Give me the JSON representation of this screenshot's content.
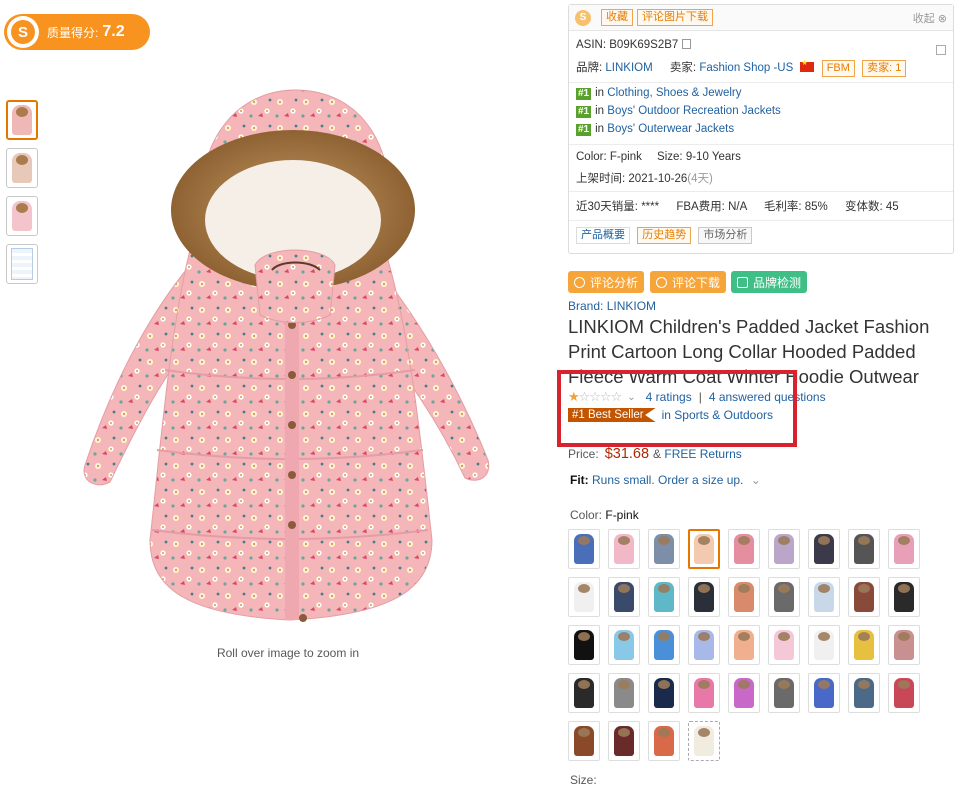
{
  "score_badge": {
    "logo": "S",
    "label": "质量得分:",
    "value": "7.2"
  },
  "thumbnails": [
    "jacket-front",
    "jacket-hood",
    "jacket-side",
    "size-chart"
  ],
  "zoom_hint": "Roll over image to zoom in",
  "info_panel": {
    "logo": "S",
    "btn_favorite": "收藏",
    "btn_review_images": "评论图片下载",
    "collapse": "收起",
    "asin_label": "ASIN:",
    "asin": "B09K69S2B7",
    "brand_label": "品牌:",
    "brand": "LINKIOM",
    "seller_label": "卖家:",
    "seller": "Fashion Shop -US",
    "fulfillment": "FBM",
    "seller_count": "卖家: 1",
    "ranks": [
      {
        "badge": "#1",
        "prefix": "in",
        "category": "Clothing, Shoes & Jewelry"
      },
      {
        "badge": "#1",
        "prefix": "in",
        "category": "Boys' Outdoor Recreation Jackets"
      },
      {
        "badge": "#1",
        "prefix": "in",
        "category": "Boys' Outerwear Jackets"
      }
    ],
    "color_label": "Color:",
    "color_value": "F-pink",
    "size_label": "Size:",
    "size_value": "9-10 Years",
    "listed_label": "上架时间:",
    "listed_date": "2021-10-26",
    "listed_days": "(4天)",
    "sales_label": "近30天销量:",
    "sales_value": "****",
    "fba_label": "FBA费用:",
    "fba_value": "N/A",
    "margin_label": "毛利率:",
    "margin_value": "85%",
    "variants_label": "变体数:",
    "variants_value": "45",
    "tab_overview": "产品概要",
    "tab_history": "历史趋势",
    "tab_market": "市场分析"
  },
  "actions": {
    "review_analysis": "评论分析",
    "review_download": "评论下载",
    "brand_check": "品牌检测"
  },
  "product": {
    "brand_link": "Brand: LINKIOM",
    "title": "LINKIOM Children's Padded Jacket Fashion Print Cartoon Long Collar Hooded Padded Fleece Warm Coat Winter Hoodie Outwear",
    "rating_stars": 1,
    "ratings_text": "4 ratings",
    "answered_text": "4 answered questions",
    "bestseller_badge": "#1 Best Seller",
    "bestseller_category": "in Sports & Outdoors",
    "price_label": "Price:",
    "price": "$31.68",
    "free_returns_prefix": "&",
    "free_returns": "FREE Returns",
    "fit_label": "Fit:",
    "fit_text": "Runs small. Order a size up.",
    "color_label": "Color:",
    "color_value": "F-pink",
    "size_label": "Size:"
  },
  "swatch_colors": [
    "#4a6fb8",
    "#f2b8c8",
    "#7d8fa8",
    "#f3c9b0",
    "#e48ea0",
    "#b9a6c9",
    "#3a3a4a",
    "#555555",
    "#e8a0b8",
    "#f0f0f0",
    "#3a4a6a",
    "#5fb8c8",
    "#2a2f3a",
    "#d88a6a",
    "#6a6a6a",
    "#c8d8e8",
    "#8a4a3a",
    "#2a2a2a",
    "#111111",
    "#8ac8e8",
    "#4a90d8",
    "#a8b8e8",
    "#f0b090",
    "#f5c8d8",
    "#f0f0f0",
    "#e8c040",
    "#c89090",
    "#2a2a2a",
    "#8a8a8a",
    "#1a2a4a",
    "#e878a8",
    "#c868c8",
    "#6a6a6a",
    "#4a68c8",
    "#4a6a88",
    "#c84858",
    "#8a4a2a",
    "#6a2a2a",
    "#d86a4a",
    "#f0ece0"
  ],
  "selected_swatch": 3,
  "dashed_swatch": 39,
  "colors": {
    "accent_orange": "#f7931e",
    "bestseller": "#c45500",
    "link": "#2162a1",
    "price": "#b12704",
    "highlight": "#d8232f",
    "rank_green": "#5aa02c"
  }
}
